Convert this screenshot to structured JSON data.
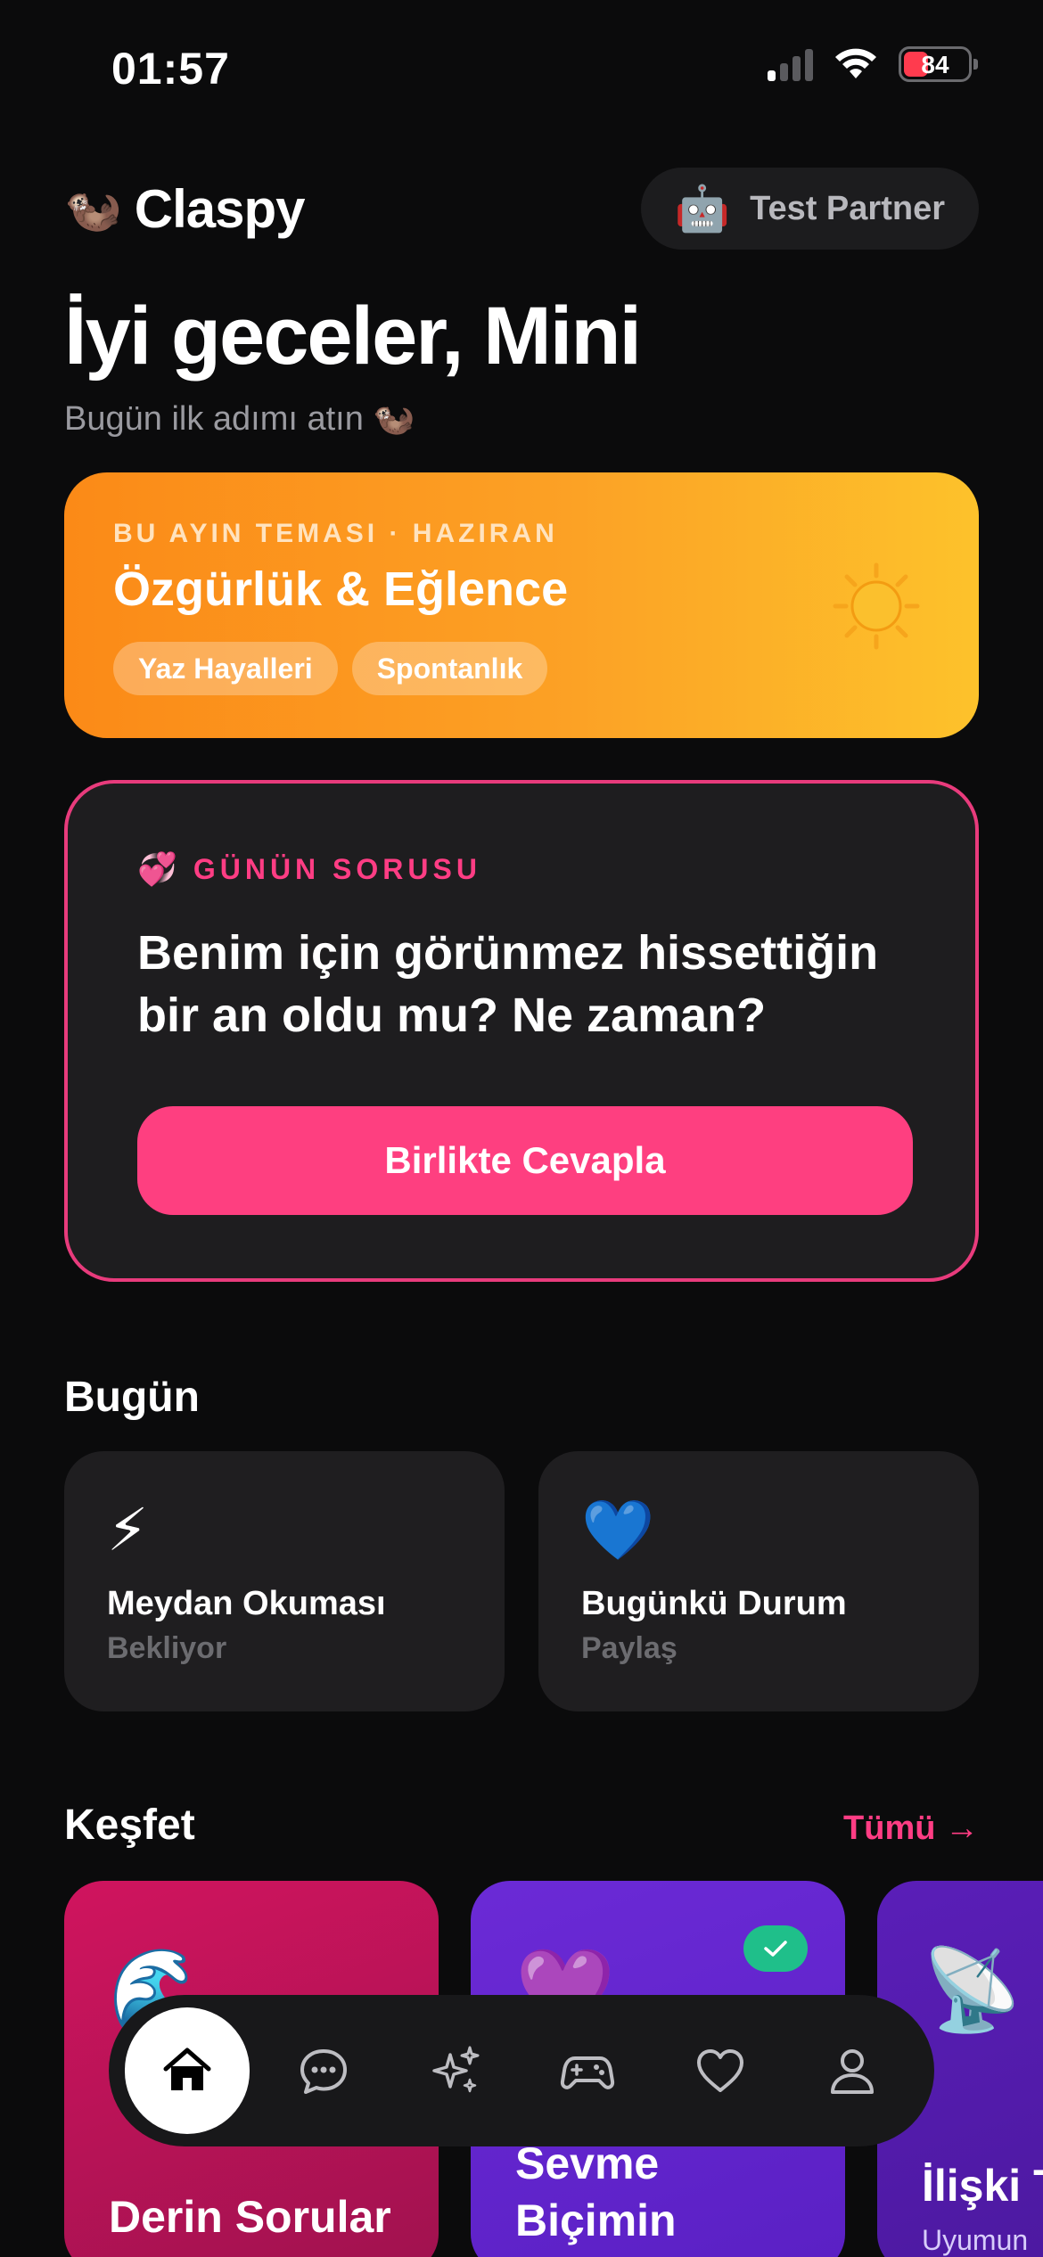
{
  "status_bar": {
    "time": "01:57",
    "battery": "84",
    "battery_color": "#ff3b4e"
  },
  "header": {
    "logo_emoji": "🦦",
    "app_name": "Claspy",
    "partner_emoji": "🤖",
    "partner_label": "Test Partner"
  },
  "greeting": {
    "title": "İyi geceler, Mini",
    "subtitle": "Bugün ilk adımı atın 🦦"
  },
  "theme_card": {
    "eyebrow": "BU AYIN TEMASI · HAZIRAN",
    "title": "Özgürlük & Eğlence",
    "tags": [
      "Yaz Hayalleri",
      "Spontanlık"
    ],
    "icon": "sun-icon",
    "gradient": [
      "#fb8a17",
      "#fdc22b"
    ]
  },
  "question_card": {
    "eyebrow_emoji": "💞",
    "eyebrow": "GÜNÜN SORUSU",
    "question": "Benim için görünmez hissettiğin bir an oldu mu? Ne zaman?",
    "button_label": "Birlikte Cevapla",
    "accent": "#fe3f80"
  },
  "today": {
    "title": "Bugün",
    "cards": [
      {
        "emoji": "⚡",
        "title": "Meydan Okuması",
        "status": "Bekliyor"
      },
      {
        "emoji": "💙",
        "title": "Bugünkü Durum",
        "status": "Paylaş"
      }
    ]
  },
  "discover": {
    "title": "Keşfet",
    "see_all": "Tümü →",
    "cards": [
      {
        "emoji": "🌊",
        "title": "Derin Sorular",
        "subtitle": ""
      },
      {
        "emoji": "💜",
        "title": "Sevme Biçimin",
        "subtitle": "",
        "completed": true
      },
      {
        "emoji": "📡",
        "title": "İlişki T",
        "subtitle": "Uyumun"
      }
    ]
  },
  "tab_bar": {
    "items": [
      "home-icon",
      "chat-icon",
      "sparkles-icon",
      "gamepad-icon",
      "heart-icon",
      "profile-icon"
    ],
    "active": "home-icon"
  }
}
